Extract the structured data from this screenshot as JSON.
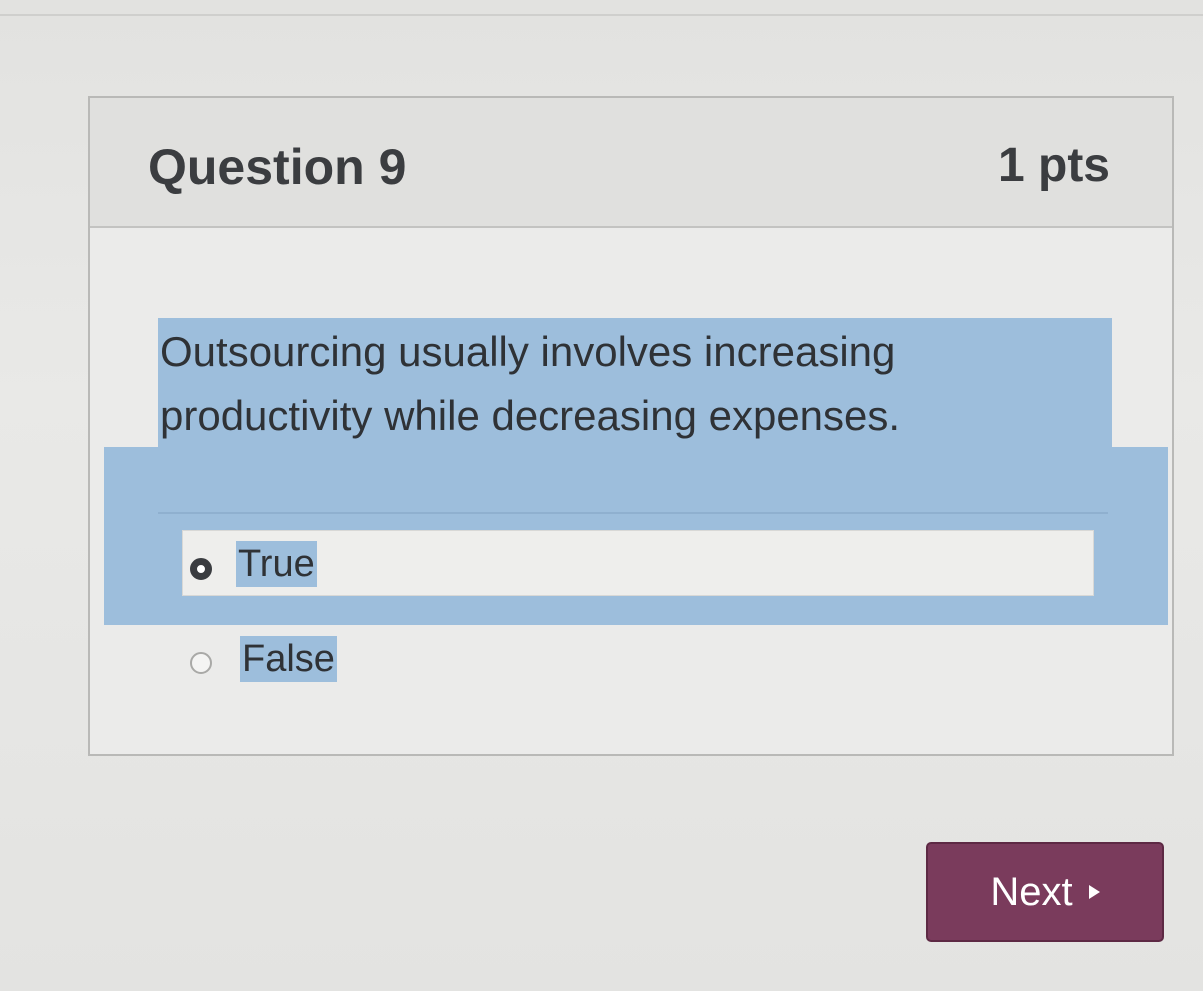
{
  "question": {
    "title": "Question 9",
    "points": "1 pts",
    "text": "Outsourcing usually involves increasing productivity while decreasing expenses."
  },
  "answers": [
    {
      "label": "True",
      "selected": true
    },
    {
      "label": "False",
      "selected": false
    }
  ],
  "navigation": {
    "next_label": "Next",
    "next_icon": "play-arrow-icon"
  },
  "colors": {
    "selection_highlight": "#9dbedc",
    "next_button": "#7a3b5c",
    "text": "#2f3236"
  }
}
